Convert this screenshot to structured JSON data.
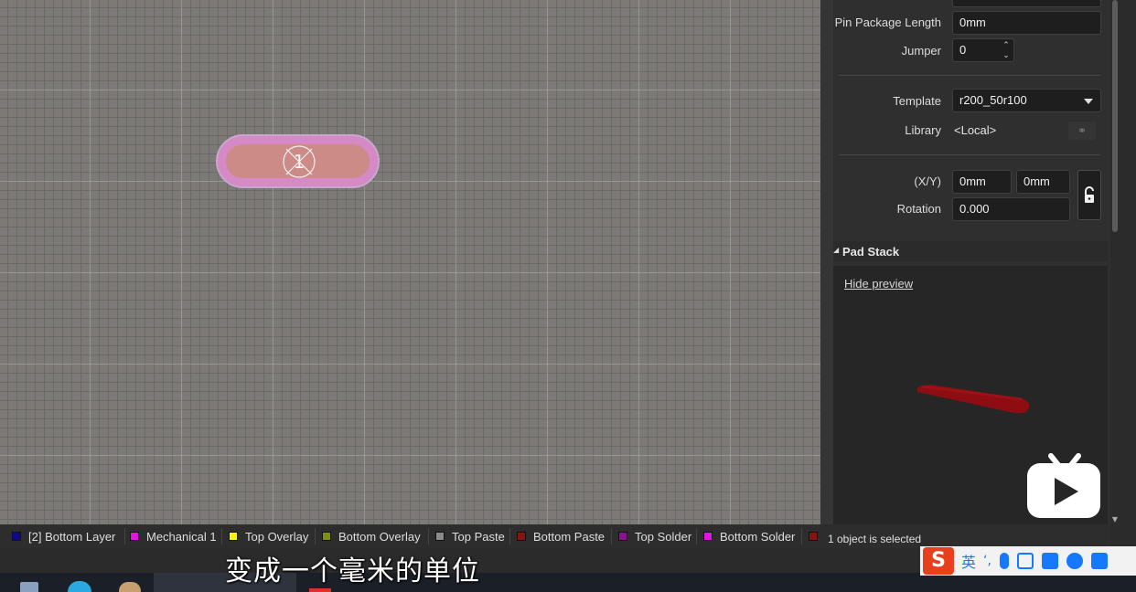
{
  "canvas": {
    "pad_number": "1"
  },
  "properties": {
    "pin_package_length_label": "Pin Package Length",
    "pin_package_length_value": "0mm",
    "jumper_label": "Jumper",
    "jumper_value": "0",
    "template_label": "Template",
    "template_value": "r200_50r100",
    "library_label": "Library",
    "library_value": "<Local>",
    "xy_label": "(X/Y)",
    "x_value": "0mm",
    "y_value": "0mm",
    "rotation_label": "Rotation",
    "rotation_value": "0.000"
  },
  "pad_stack": {
    "title": "Pad Stack",
    "hide_preview": "Hide preview"
  },
  "layers": [
    {
      "label": "[2] Bottom Layer",
      "color": "#0b0b8a"
    },
    {
      "label": "Mechanical 1",
      "color": "#e812e8"
    },
    {
      "label": "Top Overlay",
      "color": "#f5f50a"
    },
    {
      "label": "Bottom Overlay",
      "color": "#7f8f12"
    },
    {
      "label": "Top Paste",
      "color": "#8a8a8a"
    },
    {
      "label": "Bottom Paste",
      "color": "#8a1212"
    },
    {
      "label": "Top Solder",
      "color": "#8a128a"
    },
    {
      "label": "Bottom Solder",
      "color": "#e812e8"
    },
    {
      "label": "",
      "color": "#8a1212"
    }
  ],
  "status": "1 object is selected",
  "subtitle": "变成一个毫米的单位",
  "ime": {
    "logo": "S",
    "mode": "英"
  }
}
